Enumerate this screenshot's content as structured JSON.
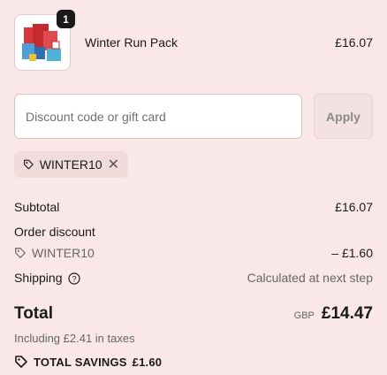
{
  "line_item": {
    "quantity": "1",
    "name": "Winter Run Pack",
    "price": "£16.07",
    "image_icon": "product-thumbnail"
  },
  "discount": {
    "placeholder": "Discount code or gift card",
    "value": "",
    "apply_label": "Apply"
  },
  "applied_code": {
    "code": "WINTER10",
    "tag_icon": "tag-icon",
    "remove_icon": "close-icon"
  },
  "summary": {
    "subtotal_label": "Subtotal",
    "subtotal_value": "£16.07",
    "order_discount_label": "Order discount",
    "discount_code": "WINTER10",
    "discount_value": "– £1.60",
    "shipping_label": "Shipping",
    "shipping_value": "Calculated at next step"
  },
  "total": {
    "label": "Total",
    "currency": "GBP",
    "amount": "£14.47",
    "taxes_note": "Including £2.41 in taxes",
    "savings_label": "TOTAL SAVINGS",
    "savings_value": "£1.60"
  },
  "colors": {
    "background": "#fae8e8",
    "text": "#1a1a1a",
    "muted": "#666666"
  }
}
